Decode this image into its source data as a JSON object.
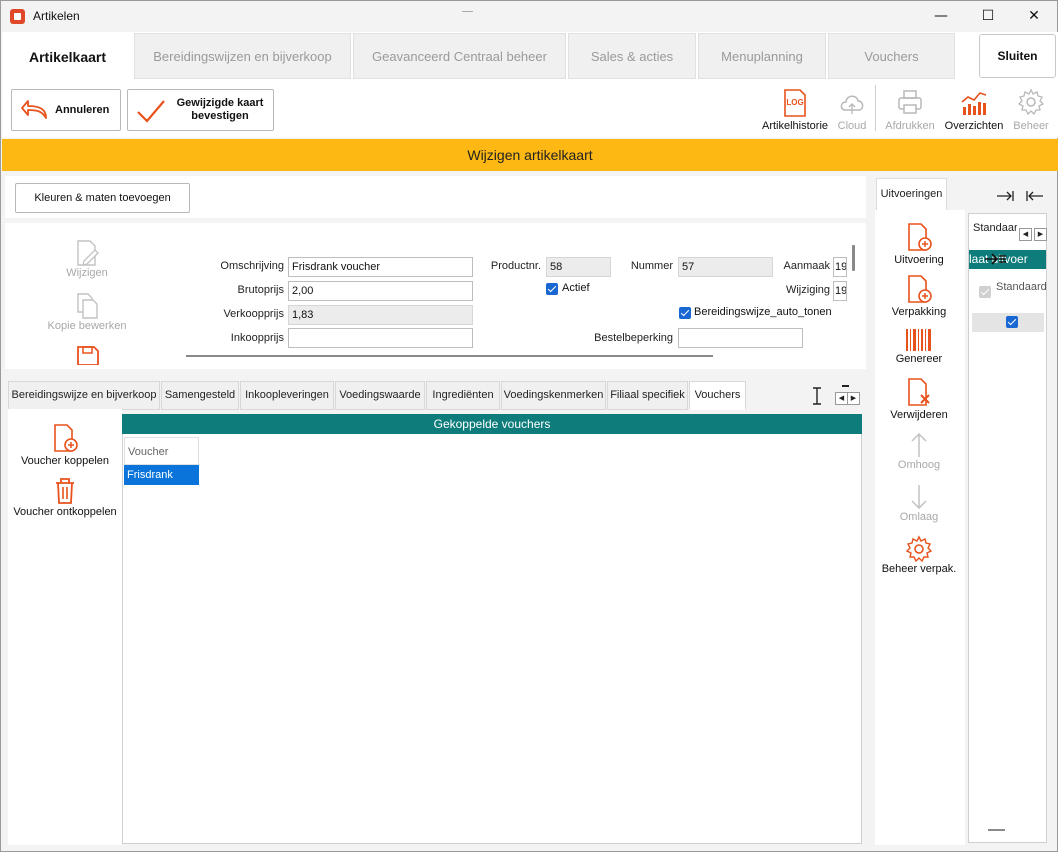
{
  "window": {
    "title": "Artikelen",
    "minimize": "—",
    "maximize": "☐",
    "close": "✕"
  },
  "top_tabs": [
    {
      "label": "Artikelkaart"
    },
    {
      "label": "Bereidingswijzen en bijverkoop"
    },
    {
      "label": "Geavanceerd Centraal beheer"
    },
    {
      "label": "Sales & acties"
    },
    {
      "label": "Menuplanning"
    },
    {
      "label": "Vouchers"
    }
  ],
  "close_button": "Sluiten",
  "actions": {
    "cancel": "Annuleren",
    "confirm_line1": "Gewijzigde kaart",
    "confirm_line2": "bevestigen"
  },
  "toolbar": {
    "log_badge": "LOG",
    "artikelhistorie": "Artikelhistorie",
    "cloud": "Cloud",
    "afdrukken": "Afdrukken",
    "overzichten": "Overzichten",
    "beheer": "Beheer"
  },
  "banner": "Wijzigen artikelkaart",
  "colors_sizes_button": "Kleuren & maten toevoegen",
  "side_tools": {
    "wijzigen": "Wijzigen",
    "kopie": "Kopie bewerken"
  },
  "form": {
    "omschrijving_label": "Omschrijving",
    "omschrijving_value": "Frisdrank voucher",
    "brutoprijs_label": "Brutoprijs",
    "brutoprijs_value": "2,00",
    "verkoopprijs_label": "Verkoopprijs",
    "verkoopprijs_value": "1,83",
    "inkoopprijs_label": "Inkoopprijs",
    "inkoopprijs_value": "",
    "productnr_label": "Productnr.",
    "productnr_value": "58",
    "actief_label": "Actief",
    "nummer_label": "Nummer",
    "nummer_value": "57",
    "aanmaak_label": "Aanmaak",
    "aanmaak_value": "19",
    "wijziging_label": "Wijziging",
    "wijziging_value": "19",
    "bereidingswijze_label": "Bereidingswijze_auto_tonen",
    "bestelbeperking_label": "Bestelbeperking",
    "bestelbeperking_value": ""
  },
  "bottom_tabs": [
    {
      "label": "Bereidingswijze en bijverkoop"
    },
    {
      "label": "Samengesteld"
    },
    {
      "label": "Inkoopleveringen"
    },
    {
      "label": "Voedingswaarde"
    },
    {
      "label": "Ingrediënten"
    },
    {
      "label": "Voedingskenmerken"
    },
    {
      "label": "Filiaal specifiek"
    },
    {
      "label": "Vouchers"
    }
  ],
  "vouchers": {
    "koppelen": "Voucher koppelen",
    "ontkoppelen": "Voucher ontkoppelen",
    "header": "Gekoppelde vouchers",
    "column": "Voucher naam",
    "rows": [
      "Frisdrank"
    ]
  },
  "uitvoeringen": {
    "tab": "Uitvoeringen",
    "tools": {
      "uitvoering": "Uitvoering",
      "verpakking": "Verpakking",
      "genereer": "Genereer",
      "verwijderen": "Verwijderen",
      "omhoog": "Omhoog",
      "omlaag": "Omlaag",
      "beheer": "Beheer verpak."
    },
    "grid_header": "Standaard",
    "teal_row": "laat uitvoer",
    "row_label": "Standaard"
  },
  "accent_color": "#e8521c",
  "teal_color": "#0f7c7c",
  "banner_color": "#fdb813"
}
